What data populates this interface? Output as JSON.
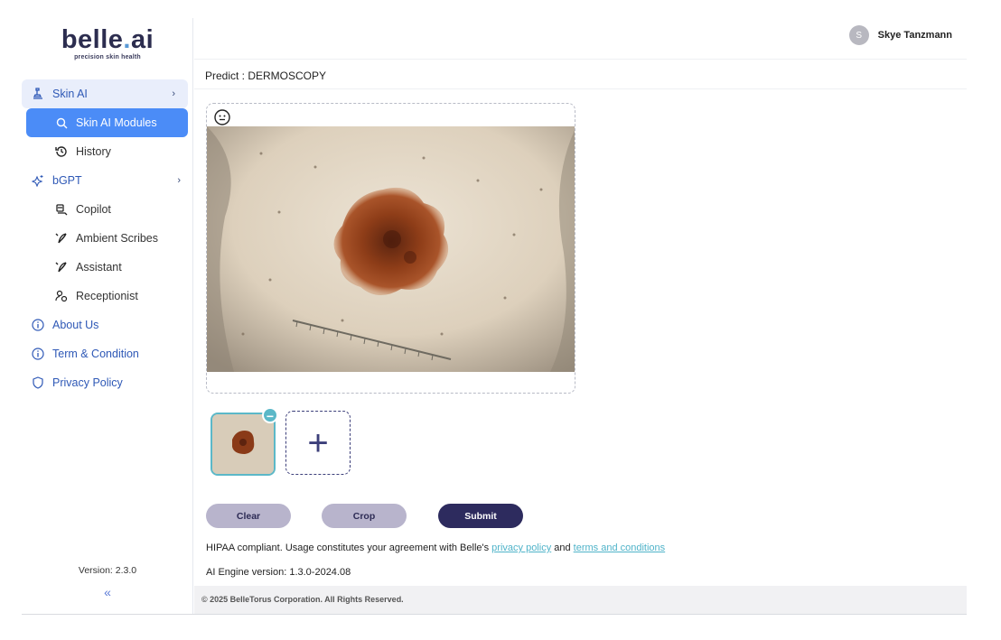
{
  "brand": {
    "name_part1": "belle",
    "name_dot": ".",
    "name_part2": "ai",
    "tagline": "precision skin health"
  },
  "user": {
    "initial": "S",
    "name": "Skye Tanzmann"
  },
  "sidebar": {
    "items": [
      {
        "label": "Skin AI",
        "icon": "microscope-icon"
      },
      {
        "label": "Skin AI Modules",
        "icon": "search-icon"
      },
      {
        "label": "History",
        "icon": "history-icon"
      },
      {
        "label": "bGPT",
        "icon": "sparkle-icon"
      },
      {
        "label": "Copilot",
        "icon": "copilot-icon"
      },
      {
        "label": "Ambient Scribes",
        "icon": "scribe-icon"
      },
      {
        "label": "Assistant",
        "icon": "assistant-icon"
      },
      {
        "label": "Receptionist",
        "icon": "receptionist-icon"
      },
      {
        "label": "About Us",
        "icon": "info-icon"
      },
      {
        "label": "Term & Condition",
        "icon": "info-icon"
      },
      {
        "label": "Privacy Policy",
        "icon": "shield-icon"
      }
    ],
    "version": "Version: 2.3.0",
    "collapse_glyph": "«"
  },
  "main": {
    "predict_title": "Predict : DERMOSCOPY",
    "buttons": {
      "clear": "Clear",
      "crop": "Crop",
      "submit": "Submit"
    },
    "hipaa_prefix": "HIPAA compliant. Usage constitutes your agreement with Belle's ",
    "privacy_link": "privacy policy",
    "and_text": " and ",
    "terms_link": "terms and conditions",
    "engine_version": "AI Engine version: 1.3.0-2024.08",
    "thumb_remove": "−",
    "add_glyph": "+"
  },
  "footer": {
    "copyright": "© 2025 BelleTorus Corporation. All Rights Reserved."
  },
  "colors": {
    "accent_blue": "#4b8cf7",
    "navy": "#2d2b5e",
    "teal": "#5bb8c8",
    "lavender": "#b8b4cc",
    "link": "#4fb3c9"
  }
}
